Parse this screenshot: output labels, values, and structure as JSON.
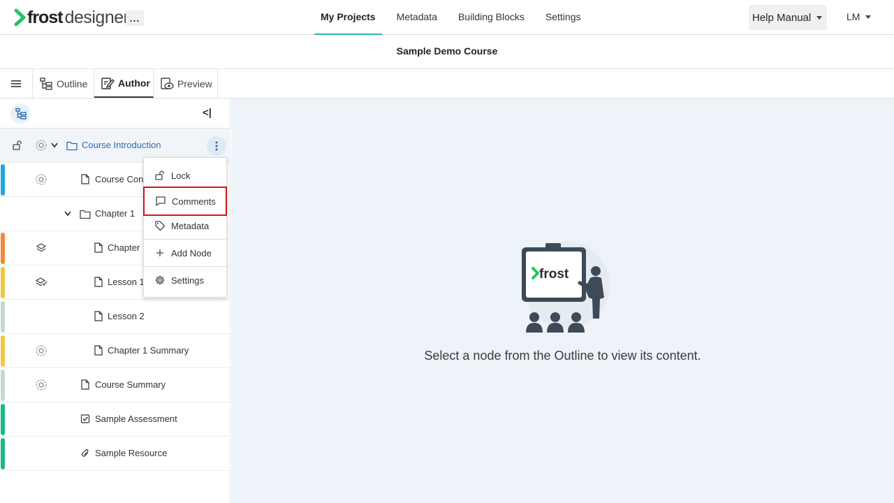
{
  "brand": {
    "word1": "frost",
    "word2": "designer",
    "accent": "#22c55e"
  },
  "header": {
    "more_label": "...",
    "nav": [
      "My Projects",
      "Metadata",
      "Building Blocks",
      "Settings"
    ],
    "active_nav": "My Projects",
    "help_label": "Help Manual",
    "user_label": "LM"
  },
  "course": {
    "title": "Sample Demo Course"
  },
  "tabs": [
    {
      "label": "Outline",
      "icon": "outline-icon"
    },
    {
      "label": "Author",
      "icon": "author-icon",
      "active": true
    },
    {
      "label": "Preview",
      "icon": "preview-icon"
    }
  ],
  "outline": {
    "collapse_label": "<|",
    "rows": [
      {
        "label": "Course Introduction",
        "type": "folder",
        "status": "draft-gear-icon",
        "bar": "",
        "selected": true
      },
      {
        "label": "Course Cont",
        "type": "page",
        "status": "draft-gear-icon",
        "bar": "#1ea7e1"
      },
      {
        "label": "Chapter 1",
        "type": "folder",
        "status": "",
        "bar": ""
      },
      {
        "label": "Chapter",
        "type": "page",
        "status": "layers-icon",
        "bar": "#f08a3c"
      },
      {
        "label": "Lesson 1",
        "type": "page",
        "status": "layers-check-icon",
        "bar": "#f2c744"
      },
      {
        "label": "Lesson 2",
        "type": "page",
        "status": "",
        "bar": "#c8d6d6"
      },
      {
        "label": "Chapter 1 Summary",
        "type": "page",
        "status": "draft-gear-icon",
        "bar": "#f2c744"
      },
      {
        "label": "Course Summary",
        "type": "page",
        "status": "draft-gear-icon",
        "bar": "#c8d6d6"
      },
      {
        "label": "Sample Assessment",
        "type": "assessment",
        "status": "",
        "bar": "#19b88a"
      },
      {
        "label": "Sample Resource",
        "type": "resource",
        "status": "",
        "bar": "#19b88a"
      }
    ]
  },
  "context_menu": {
    "items": [
      {
        "label": "Lock",
        "icon": "lock-icon"
      },
      {
        "label": "Comments",
        "icon": "comment-icon",
        "highlighted": true
      },
      {
        "label": "Metadata",
        "icon": "tag-icon"
      },
      {
        "label": "Add Node",
        "icon": "plus-icon"
      },
      {
        "label": "Settings",
        "icon": "gear-icon"
      }
    ]
  },
  "main": {
    "illustration_text": "frost",
    "empty_message": "Select a node from the Outline to view its content."
  },
  "colors": {
    "tab_accent": "#28b4b4",
    "highlight_border": "#d0161b",
    "main_bg": "#eef3f9"
  }
}
